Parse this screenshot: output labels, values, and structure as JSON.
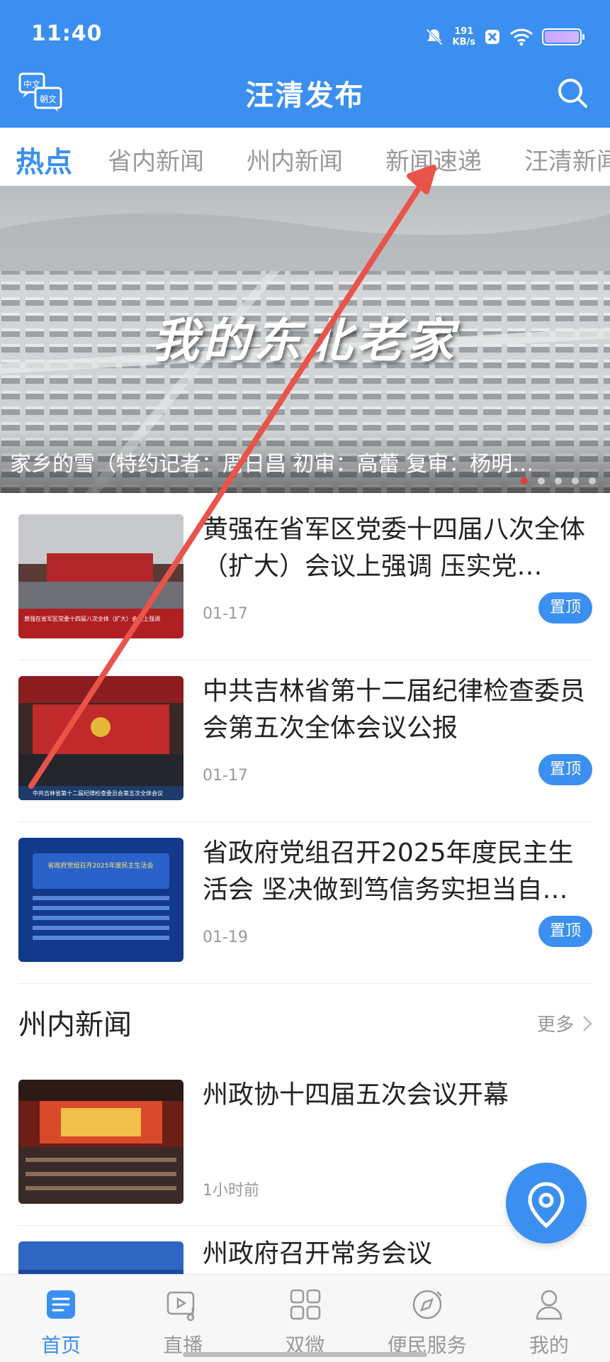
{
  "status_bar": {
    "time": "11:40",
    "speed_value": "191",
    "speed_unit": "KB/s"
  },
  "header": {
    "title": "汪清发布",
    "lang_badge_top": "中文",
    "lang_badge_bottom": "朝文"
  },
  "tabs": [
    {
      "label": "热点",
      "active": true
    },
    {
      "label": "省内新闻",
      "active": false
    },
    {
      "label": "州内新闻",
      "active": false
    },
    {
      "label": "新闻速递",
      "active": false
    },
    {
      "label": "汪清新闻",
      "active": false
    }
  ],
  "banner": {
    "overlay_text": "我的东北老家",
    "caption": "家乡的雪（特约记者：周日昌 初审：高蕾 复审：杨明…",
    "dot_count": 5,
    "active_dot": 0
  },
  "top_news": [
    {
      "title": "黄强在省军区党委十四届八次全体（扩大）会议上强调 压实党…",
      "date": "01-17",
      "badge": "置顶",
      "thumb_caption": "黄强在省军区党委十四届八次全体（扩大）会议上强调"
    },
    {
      "title": "中共吉林省第十二届纪律检查委员会第五次全体会议公报",
      "date": "01-17",
      "badge": "置顶",
      "thumb_caption": "中共吉林省第十二届纪律检查委员会第五次全体会议"
    },
    {
      "title": "省政府党组召开2025年度民主生活会 坚决做到笃信务实担当自…",
      "date": "01-19",
      "badge": "置顶",
      "thumb_caption": "省政府党组召开2025年度民主生活会"
    }
  ],
  "section": {
    "title": "州内新闻",
    "more_label": "更多"
  },
  "section_news": [
    {
      "title": "州政协十四届五次会议开幕",
      "date": "1小时前"
    },
    {
      "title": "州政府召开常务会议",
      "date": ""
    }
  ],
  "bottom_nav": [
    {
      "label": "首页",
      "icon": "home-news-icon",
      "active": true
    },
    {
      "label": "直播",
      "icon": "live-video-icon",
      "active": false
    },
    {
      "label": "双微",
      "icon": "grid-icon",
      "active": false
    },
    {
      "label": "便民服务",
      "icon": "compass-service-icon",
      "active": false
    },
    {
      "label": "我的",
      "icon": "user-icon",
      "active": false
    }
  ],
  "colors": {
    "primary": "#3b8ff0",
    "annotation_arrow": "#e9534a"
  }
}
